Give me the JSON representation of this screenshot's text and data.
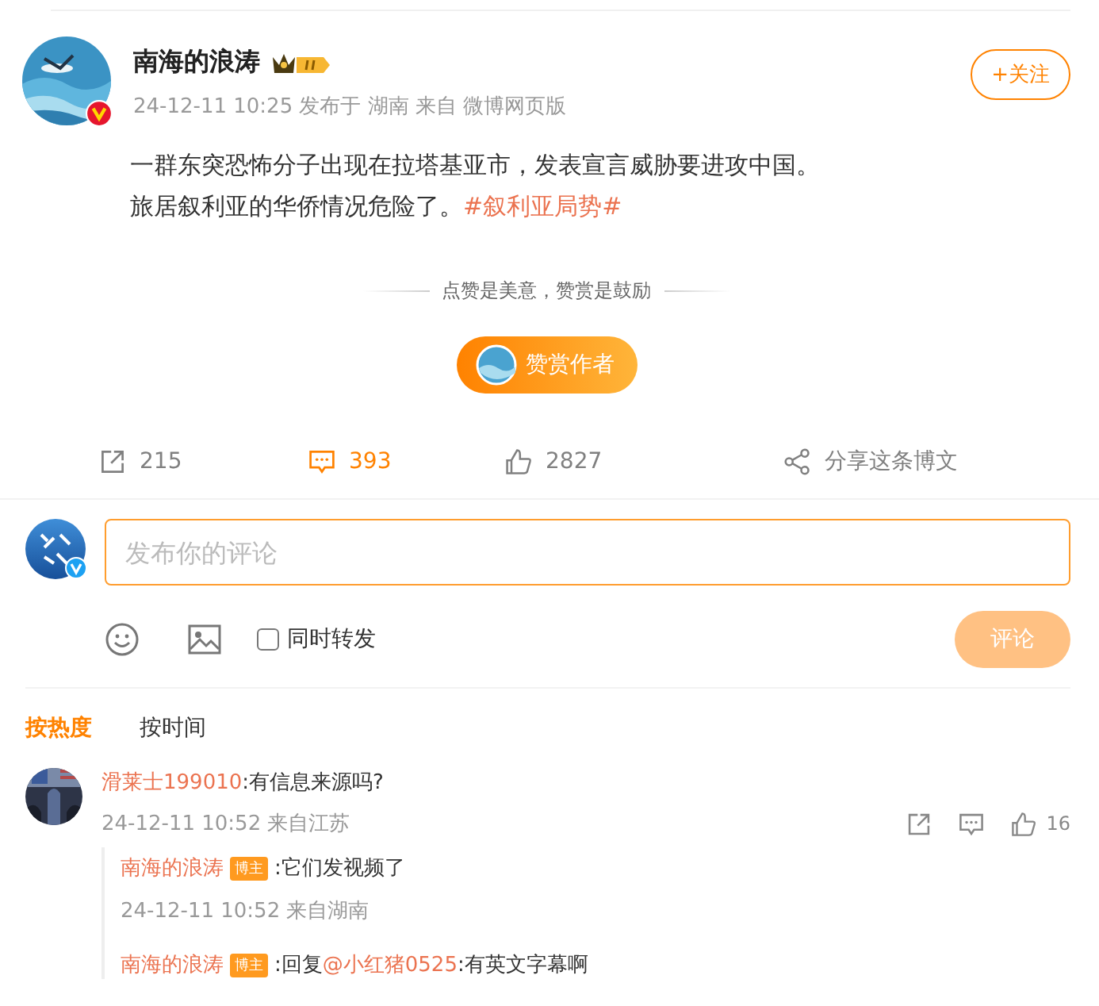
{
  "post": {
    "author": "南海的浪涛",
    "verified": true,
    "meta": "24-12-11 10:25 发布于 湖南 来自 微博网页版",
    "follow_button": "+关注",
    "body_lines": [
      [
        {
          "kind": "plain",
          "text": "一群东突恐怖分子出现在拉塔基亚市，发表宣言威胁要进攻中国。"
        }
      ],
      [
        {
          "kind": "plain",
          "text": "旅居叙利亚的华侨情况危险了。"
        },
        {
          "kind": "topic",
          "text": "#叙利亚局势#"
        }
      ]
    ],
    "reward_caption": "点赞是美意，赞赏是鼓励",
    "reward_button": "赞赏作者"
  },
  "actions": [
    {
      "kind": "repost",
      "label": "215",
      "selected": false
    },
    {
      "kind": "comment",
      "label": "393",
      "selected": true
    },
    {
      "kind": "like",
      "label": "2827",
      "selected": false
    },
    {
      "kind": "share",
      "label": "分享这条博文",
      "selected": false
    }
  ],
  "composer": {
    "placeholder": "发布你的评论",
    "repost_option": "同时转发",
    "checked": false,
    "submit": "评论"
  },
  "sort_tabs": [
    {
      "label": "按热度",
      "selected": true
    },
    {
      "label": "按时间",
      "selected": false
    }
  ],
  "comments": [
    {
      "author": "滑莱士199010",
      "text": ":有信息来源吗?",
      "time": "24-12-11 10:52 来自江苏",
      "likes": "16",
      "replies": [
        {
          "author": "南海的浪涛",
          "badge": "博主",
          "parts": [
            {
              "kind": "plain",
              "text": ":它们发视频了"
            }
          ],
          "time": "24-12-11 10:52 来自湖南"
        },
        {
          "author": "南海的浪涛",
          "badge": "博主",
          "parts": [
            {
              "kind": "plain",
              "text": ":回复"
            },
            {
              "kind": "mention",
              "text": "@小红猪0525"
            },
            {
              "kind": "plain",
              "text": ":有英文字幕啊"
            }
          ]
        }
      ]
    }
  ]
}
